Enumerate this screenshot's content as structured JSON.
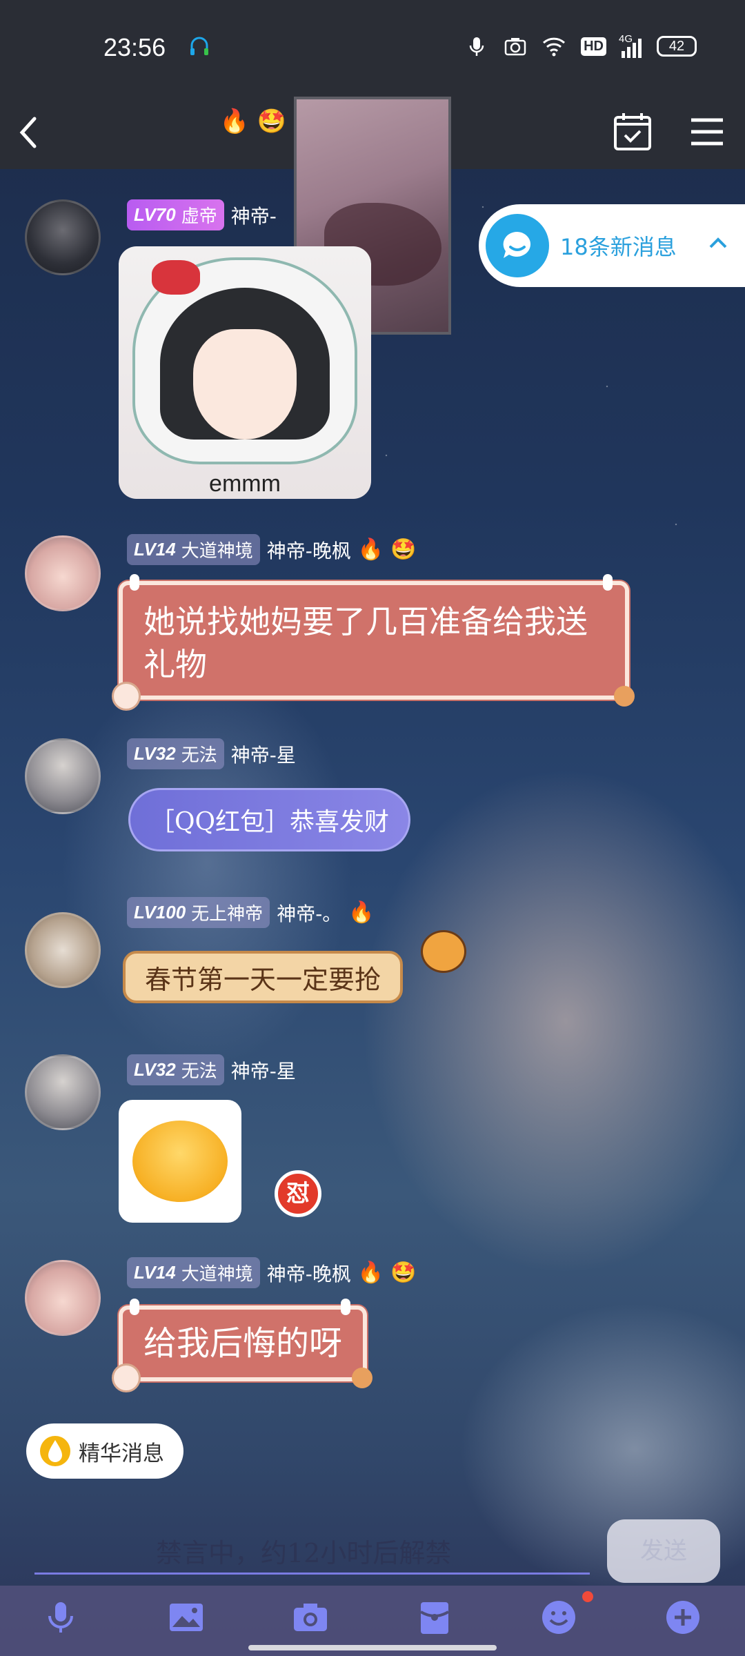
{
  "status": {
    "time": "23:56",
    "battery": "42",
    "network": "4G",
    "hd": "HD"
  },
  "nav": {
    "title_emojis": [
      "🔥",
      "🤩"
    ]
  },
  "new_messages": {
    "label": "18条新消息"
  },
  "messages": [
    {
      "level": "LV70",
      "title": "虚帝",
      "nick": "神帝-",
      "type": "image",
      "caption": "emmm"
    },
    {
      "level": "LV14",
      "title": "大道神境",
      "nick": "神帝-晚枫",
      "emojis": [
        "🔥",
        "🤩"
      ],
      "type": "text",
      "text": "她说找她妈要了几百准备给我送礼物"
    },
    {
      "level": "LV32",
      "title": "无法",
      "nick": "神帝-星",
      "type": "redpacket",
      "text": "［QQ红包］恭喜发财"
    },
    {
      "level": "LV100",
      "title": "无上神帝",
      "nick": "神帝-。",
      "emojis": [
        "🔥"
      ],
      "type": "text",
      "text": "春节第一天一定要抢"
    },
    {
      "level": "LV32",
      "title": "无法",
      "nick": "神帝-星",
      "type": "sticker",
      "badge": "怼"
    },
    {
      "level": "LV14",
      "title": "大道神境",
      "nick": "神帝-晚枫",
      "emojis": [
        "🔥",
        "🤩"
      ],
      "type": "text",
      "text": "给我后悔的呀"
    }
  ],
  "essence": {
    "label": "精华消息"
  },
  "input": {
    "muted_text": "禁言中，约12小时后解禁",
    "send_label": "发送"
  },
  "toolbar": {
    "icons": [
      "microphone-icon",
      "image-icon",
      "camera-icon",
      "red-packet-icon",
      "emoji-icon",
      "plus-icon"
    ]
  },
  "colors": {
    "accent_blue": "#26a8e6",
    "bubble_red": "#d0726a",
    "bubble_purple": "#7a78e0"
  }
}
